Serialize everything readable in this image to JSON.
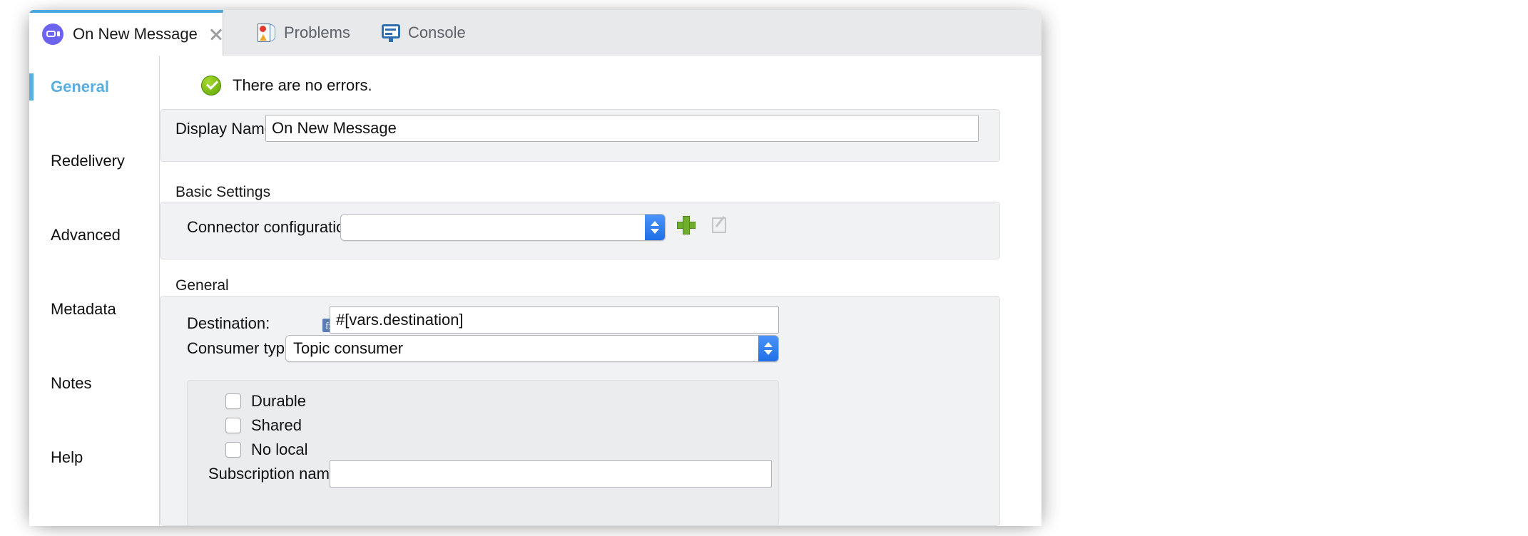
{
  "window": {
    "tabs": [
      {
        "label": "On New Message",
        "icon": "message-icon",
        "active": true,
        "close": true
      },
      {
        "label": "Problems",
        "icon": "problems-icon",
        "active": false
      },
      {
        "label": "Console",
        "icon": "console-icon",
        "active": false
      }
    ]
  },
  "sidebar": {
    "items": [
      {
        "label": "General",
        "selected": true
      },
      {
        "label": "Redelivery",
        "selected": false
      },
      {
        "label": "Advanced",
        "selected": false
      },
      {
        "label": "Metadata",
        "selected": false
      },
      {
        "label": "Notes",
        "selected": false
      },
      {
        "label": "Help",
        "selected": false
      }
    ]
  },
  "status": {
    "icon": "check-circle-icon",
    "text": "There are no errors."
  },
  "display_name": {
    "label": "Display Name:",
    "value": "On New Message",
    "placeholder": ""
  },
  "basic_settings": {
    "title": "Basic Settings",
    "connector_configuration": {
      "label": "Connector configuration:",
      "value": "",
      "add_icon": "plus-icon",
      "edit_icon": "edit-pencil-icon"
    }
  },
  "general": {
    "title": "General",
    "destination": {
      "label": "Destination:",
      "value": "#[vars.destination]",
      "badge": "fx"
    },
    "consumer_type": {
      "label": "Consumer type",
      "value": "Topic consumer"
    },
    "checkboxes": [
      {
        "label": "Durable",
        "checked": false
      },
      {
        "label": "Shared",
        "checked": false
      },
      {
        "label": "No local",
        "checked": false
      }
    ],
    "subscription_name": {
      "label": "Subscription name:",
      "value": "",
      "placeholder": ""
    }
  },
  "colors": {
    "accent": "#5aaee0",
    "tab_top": "#4aa8dd",
    "ok_green": "#74b511",
    "combo_blue": "#1f6fe8",
    "badge_blue": "#5b7fb4"
  }
}
